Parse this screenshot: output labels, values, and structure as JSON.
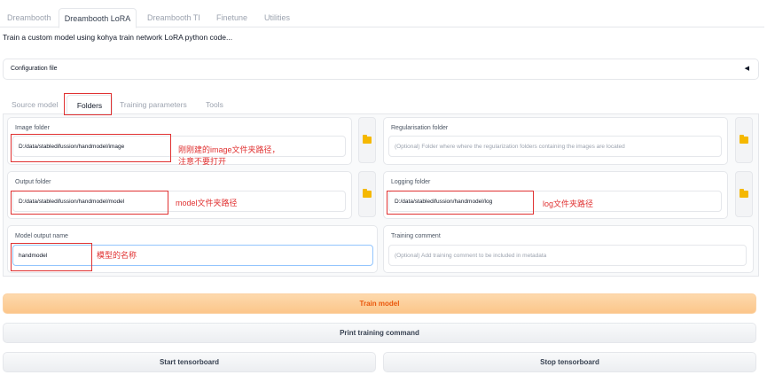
{
  "top_tabs": [
    {
      "label": "Dreambooth"
    },
    {
      "label": "Dreambooth LoRA"
    },
    {
      "label": "Dreambooth TI"
    },
    {
      "label": "Finetune"
    },
    {
      "label": "Utilities"
    }
  ],
  "active_top_tab": "Dreambooth LoRA",
  "description": "Train a custom model using kohya train network LoRA python code...",
  "config": {
    "label": "Configuration file",
    "toggle_icon": "triangle-left"
  },
  "sub_tabs": [
    {
      "label": "Source model"
    },
    {
      "label": "Folders"
    },
    {
      "label": "Training parameters"
    },
    {
      "label": "Tools"
    }
  ],
  "active_sub_tab": "Folders",
  "folders": {
    "image_folder": {
      "label": "Image folder",
      "value": "D:/data/stabledifussion/handmodel/image"
    },
    "regularisation_folder": {
      "label": "Regularisation folder",
      "placeholder": "(Optional) Folder where where the regularization folders containing the images are located"
    },
    "output_folder": {
      "label": "Output folder",
      "value": "D:/data/stabledifussion/handmodel/model"
    },
    "logging_folder": {
      "label": "Logging folder",
      "value": "D:/data/stabledifussion/handmodel/log"
    },
    "model_output_name": {
      "label": "Model output name",
      "value": "handmodel"
    },
    "training_comment": {
      "label": "Training comment",
      "placeholder": "(Optional) Add training comment to be included in metadata"
    }
  },
  "annotations": {
    "image_note_line1": "刚刚建的image文件夹路径，",
    "image_note_line2": "注意不要打开",
    "model_note": "model文件夹路径",
    "log_note": "log文件夹路径",
    "name_note": "模型的名称"
  },
  "buttons": {
    "train_model": "Train model",
    "print_command": "Print training command",
    "start_tensorboard": "Start tensorboard",
    "stop_tensorboard": "Stop tensorboard"
  },
  "colors": {
    "accent_orange": "#ea580c",
    "annotation_red": "#e03131",
    "folder_icon": "#f5b800"
  }
}
